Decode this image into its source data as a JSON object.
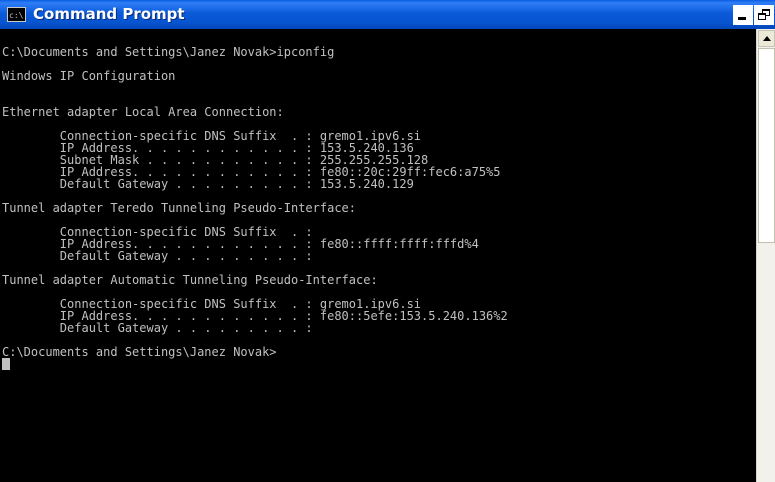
{
  "window": {
    "title": "Command Prompt",
    "icon_text": "c:\\"
  },
  "console": {
    "lines": [
      "",
      "C:\\Documents and Settings\\Janez Novak>ipconfig",
      "",
      "Windows IP Configuration",
      "",
      "",
      "Ethernet adapter Local Area Connection:",
      "",
      "        Connection-specific DNS Suffix  . : gremo1.ipv6.si",
      "        IP Address. . . . . . . . . . . . : 153.5.240.136",
      "        Subnet Mask . . . . . . . . . . . : 255.255.255.128",
      "        IP Address. . . . . . . . . . . . : fe80::20c:29ff:fec6:a75%5",
      "        Default Gateway . . . . . . . . . : 153.5.240.129",
      "",
      "Tunnel adapter Teredo Tunneling Pseudo-Interface:",
      "",
      "        Connection-specific DNS Suffix  . :",
      "        IP Address. . . . . . . . . . . . : fe80::ffff:ffff:fffd%4",
      "        Default Gateway . . . . . . . . . :",
      "",
      "Tunnel adapter Automatic Tunneling Pseudo-Interface:",
      "",
      "        Connection-specific DNS Suffix  . : gremo1.ipv6.si",
      "        IP Address. . . . . . . . . . . . : fe80::5efe:153.5.240.136%2",
      "        Default Gateway . . . . . . . . . :",
      ""
    ],
    "prompt": "C:\\Documents and Settings\\Janez Novak>"
  },
  "colors": {
    "titlebar": "#0754cf",
    "console_bg": "#000000",
    "console_text": "#c0c0c0"
  },
  "icons": {
    "app": "console-icon",
    "minimize": "minimize-icon",
    "maximize": "restore-icon",
    "close": "close-icon",
    "scroll_up": "arrow-up-icon"
  }
}
